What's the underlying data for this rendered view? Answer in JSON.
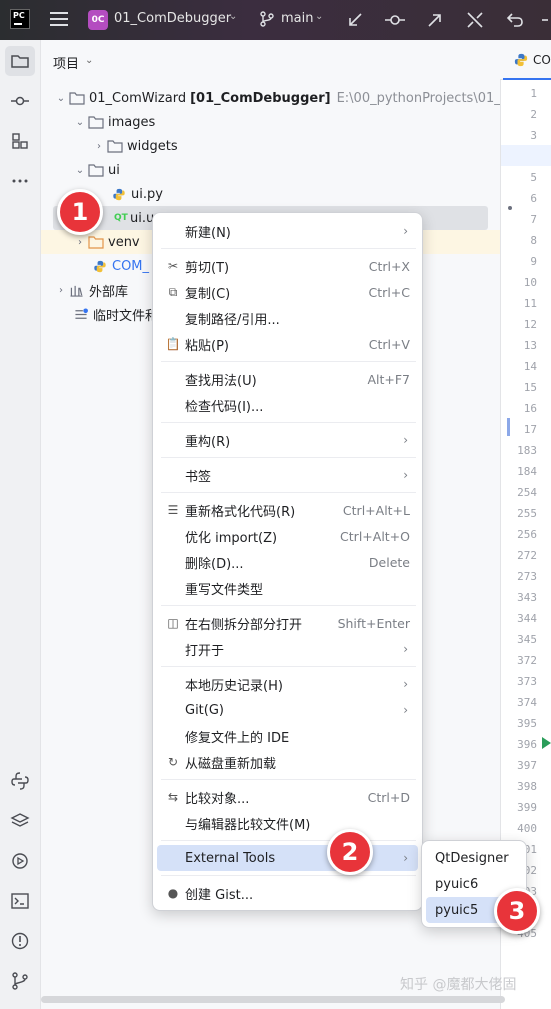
{
  "titlebar": {
    "logo": "PC",
    "project_badge": "0C",
    "project_name": "01_ComDebugger",
    "branch": "main"
  },
  "panel": {
    "title": "项目"
  },
  "tree": [
    {
      "label": "01_ComWizard",
      "bold": "[01_ComDebugger]",
      "path": "E:\\00_pythonProjects\\01_Com"
    },
    {
      "label": "images"
    },
    {
      "label": "widgets"
    },
    {
      "label": "ui"
    },
    {
      "label": "ui.py"
    },
    {
      "label": "ui.u"
    },
    {
      "label": "venv"
    },
    {
      "label": "COM_"
    },
    {
      "label": "外部库"
    },
    {
      "label": "临时文件和"
    }
  ],
  "editor": {
    "tab": "CO",
    "line_numbers": [
      "1",
      "2",
      "3",
      "4",
      "5",
      "6",
      "7",
      "8",
      "9",
      "10",
      "11",
      "12",
      "13",
      "14",
      "15",
      "16",
      "17",
      "183",
      "184",
      "254",
      "255",
      "256",
      "272",
      "273",
      "343",
      "344",
      "345",
      "372",
      "373",
      "374",
      "395",
      "396",
      "397",
      "398",
      "399",
      "400",
      "401",
      "402",
      "403",
      "404",
      "405"
    ]
  },
  "context_menu": {
    "items": [
      {
        "label": "新建(N)",
        "shortcut": "",
        "submenu": true,
        "icon": ""
      },
      {
        "label": "剪切(T)",
        "shortcut": "Ctrl+X",
        "icon": "scissors-icon",
        "glyph": "✂"
      },
      {
        "label": "复制(C)",
        "shortcut": "Ctrl+C",
        "icon": "copy-icon",
        "glyph": "⧉"
      },
      {
        "label": "复制路径/引用...",
        "shortcut": ""
      },
      {
        "label": "粘贴(P)",
        "shortcut": "Ctrl+V",
        "icon": "paste-icon",
        "glyph": "📋"
      },
      {
        "label": "查找用法(U)",
        "shortcut": "Alt+F7"
      },
      {
        "label": "检查代码(I)...",
        "shortcut": ""
      },
      {
        "label": "重构(R)",
        "submenu": true
      },
      {
        "label": "书签",
        "submenu": true
      },
      {
        "label": "重新格式化代码(R)",
        "shortcut": "Ctrl+Alt+L",
        "icon": "reformat-icon",
        "glyph": "☰"
      },
      {
        "label": "优化 import(Z)",
        "shortcut": "Ctrl+Alt+O"
      },
      {
        "label": "删除(D)...",
        "shortcut": "Delete"
      },
      {
        "label": "重写文件类型",
        "shortcut": ""
      },
      {
        "label": "在右侧拆分部分打开",
        "shortcut": "Shift+Enter",
        "icon": "split-icon",
        "glyph": "◫"
      },
      {
        "label": "打开于",
        "submenu": true
      },
      {
        "label": "本地历史记录(H)",
        "submenu": true
      },
      {
        "label": "Git(G)",
        "submenu": true
      },
      {
        "label": "修复文件上的 IDE",
        "shortcut": ""
      },
      {
        "label": "从磁盘重新加载",
        "icon": "reload-icon",
        "glyph": "↻"
      },
      {
        "label": "比较对象...",
        "shortcut": "Ctrl+D",
        "icon": "compare-icon",
        "glyph": "⇆"
      },
      {
        "label": "与编辑器比较文件(M)",
        "shortcut": ""
      },
      {
        "label": "External Tools",
        "submenu": true,
        "highlighted": true
      },
      {
        "label": "创建 Gist...",
        "icon": "github-icon",
        "glyph": "●"
      }
    ]
  },
  "submenu": {
    "items": [
      "QtDesigner",
      "pyuic6",
      "pyuic5"
    ],
    "highlighted": "pyuic5"
  },
  "badges": [
    "1",
    "2",
    "3"
  ],
  "watermark": "知乎 @魔都大佬固",
  "colors": {
    "accent": "#3574f0",
    "highlight": "#d5e1f8",
    "badge": "#e8343a",
    "project_badge": "#b44dc0"
  }
}
